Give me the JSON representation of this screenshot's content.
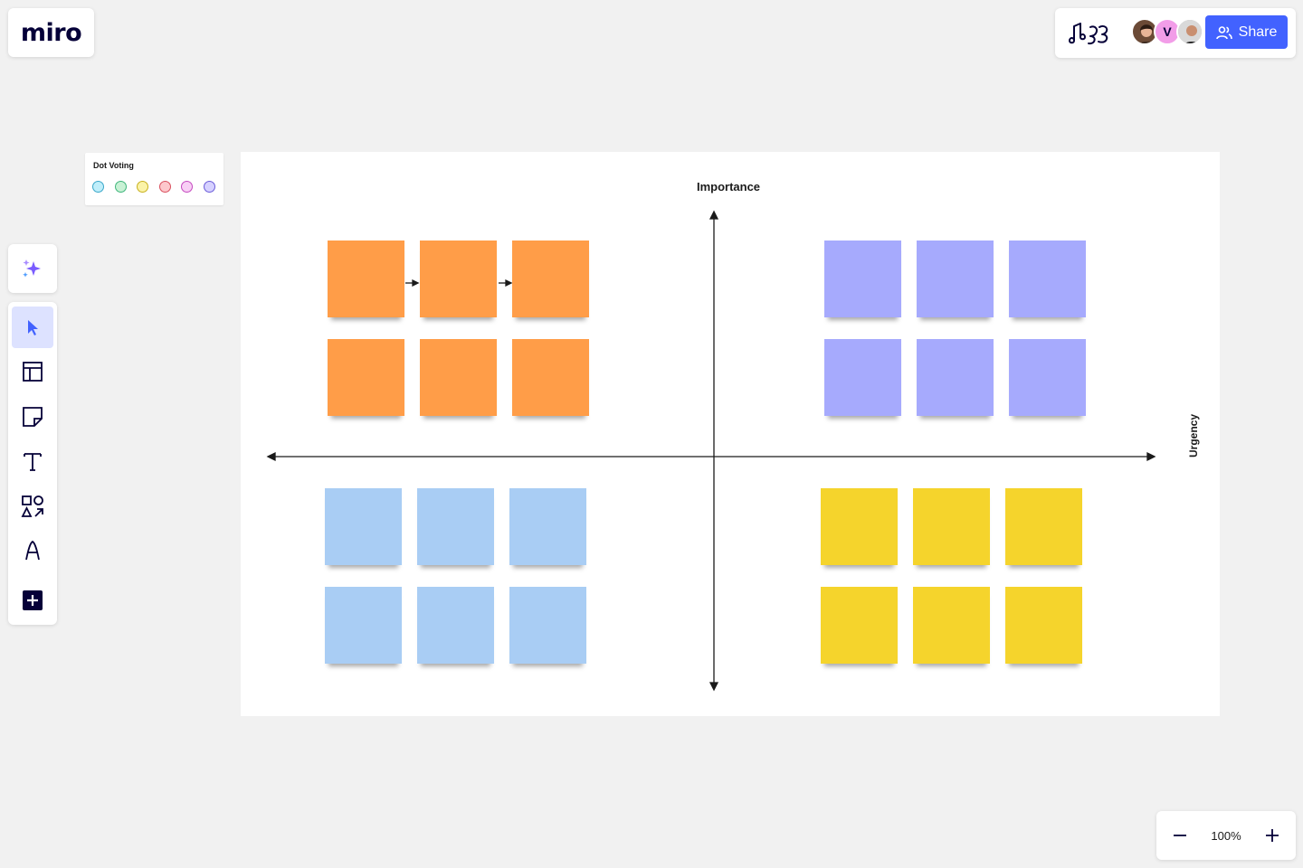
{
  "app": {
    "logo_text": "miro"
  },
  "header": {
    "share_label": "Share",
    "collaborators": [
      {
        "name": "collaborator-photo-1",
        "initial": ""
      },
      {
        "name": "collaborator-v",
        "initial": "V"
      },
      {
        "name": "collaborator-photo-3",
        "initial": ""
      }
    ]
  },
  "toolbar": {
    "ai_icon": "sparkles-icon",
    "tools": [
      {
        "name": "select-tool",
        "icon": "cursor-icon",
        "active": true
      },
      {
        "name": "templates-tool",
        "icon": "layout-icon",
        "active": false
      },
      {
        "name": "sticky-note-tool",
        "icon": "sticky-note-icon",
        "active": false
      },
      {
        "name": "text-tool",
        "icon": "text-icon",
        "active": false
      },
      {
        "name": "shapes-tool",
        "icon": "shapes-icon",
        "active": false
      },
      {
        "name": "pen-tool",
        "icon": "pen-icon",
        "active": false
      },
      {
        "name": "more-tools",
        "icon": "plus-square-icon",
        "active": false
      }
    ]
  },
  "dot_voting": {
    "title": "Dot Voting",
    "dots": [
      {
        "fill": "#bfeefa",
        "stroke": "#3aa7c9"
      },
      {
        "fill": "#c8f1d5",
        "stroke": "#3db57a"
      },
      {
        "fill": "#fbf3a8",
        "stroke": "#c8b11e"
      },
      {
        "fill": "#fdc8cc",
        "stroke": "#d9505e"
      },
      {
        "fill": "#f8cff5",
        "stroke": "#c54ac0"
      },
      {
        "fill": "#d6d1ff",
        "stroke": "#6b5cd9"
      }
    ]
  },
  "board": {
    "vertical_axis_label": "Importance",
    "horizontal_axis_label": "Urgency",
    "quadrants": [
      {
        "name": "top-left",
        "color": "#ff9d48",
        "count": 6
      },
      {
        "name": "top-right",
        "color": "#a6aafd",
        "count": 6
      },
      {
        "name": "bottom-left",
        "color": "#a9cdf4",
        "count": 6
      },
      {
        "name": "bottom-right",
        "color": "#f5d42c",
        "count": 6
      }
    ]
  },
  "zoom": {
    "level": "100%"
  },
  "colors": {
    "accent": "#4262ff",
    "ink": "#050038"
  }
}
